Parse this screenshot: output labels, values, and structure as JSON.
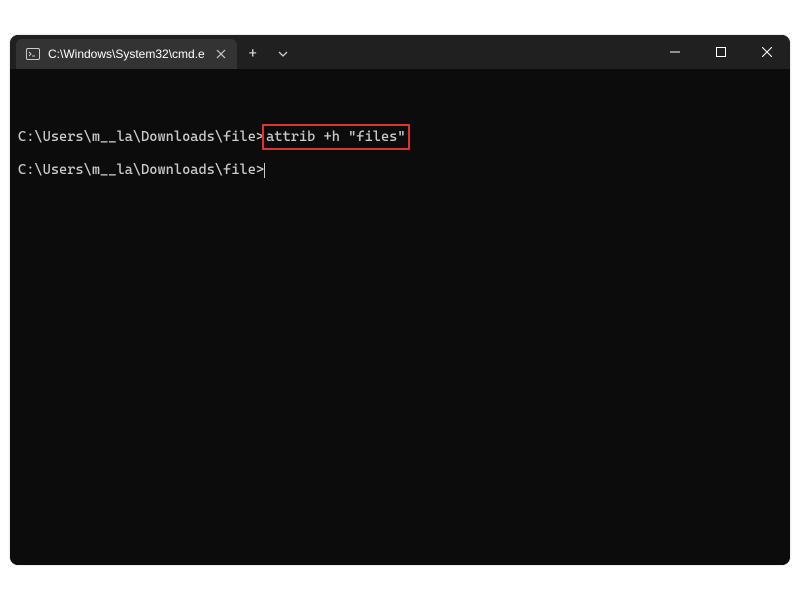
{
  "titlebar": {
    "tab_title": "C:\\Windows\\System32\\cmd.e",
    "new_tab_label": "+",
    "dropdown_label": "⌄"
  },
  "terminal": {
    "line1_prompt": "C:\\Users\\m__la\\Downloads\\file>",
    "line1_command": "attrib +h \"files\"",
    "line2_prompt": "C:\\Users\\m__la\\Downloads\\file>"
  }
}
